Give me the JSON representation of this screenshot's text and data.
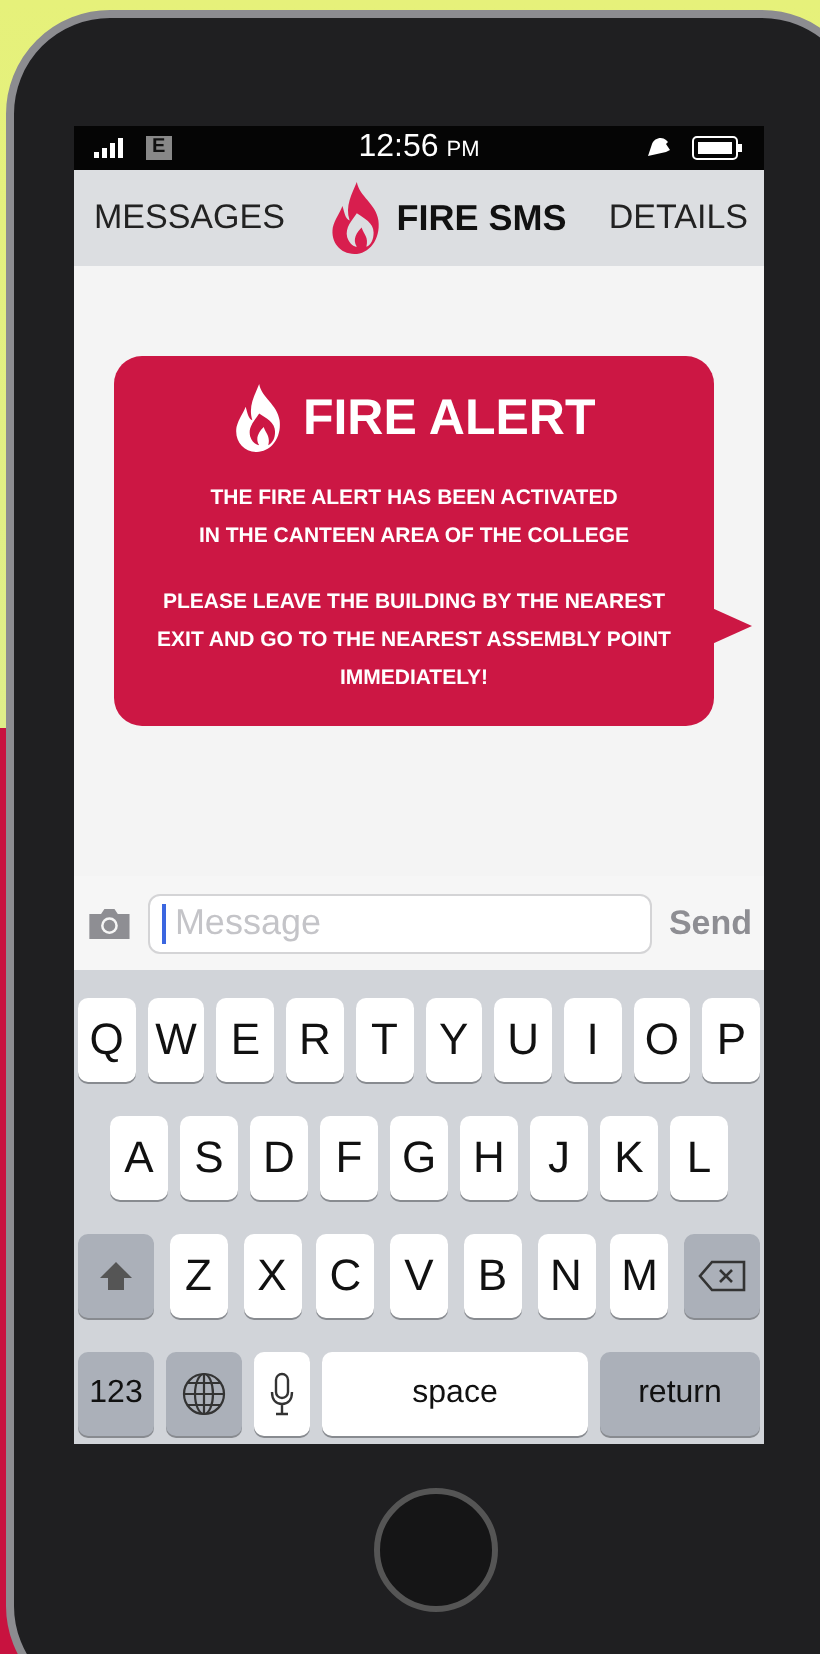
{
  "status_bar": {
    "network": "E",
    "time": "12:56",
    "ampm": "PM"
  },
  "nav": {
    "back": "MESSAGES",
    "title": "FIRE SMS",
    "details": "DETAILS"
  },
  "message": {
    "title": "FIRE ALERT",
    "paragraphs": [
      "THE FIRE ALERT HAS BEEN ACTIVATED\nIN THE CANTEEN AREA OF THE COLLEGE",
      "PLEASE LEAVE THE BUILDING BY THE NEAREST\nEXIT AND GO TO THE NEAREST ASSEMBLY POINT\nIMMEDIATELY!"
    ]
  },
  "compose": {
    "placeholder": "Message",
    "send": "Send"
  },
  "keyboard": {
    "top_row": [
      {
        "kind": "letter",
        "label": "Q"
      },
      {
        "kind": "letter",
        "label": "W"
      },
      {
        "kind": "letter",
        "label": "E"
      },
      {
        "kind": "letter",
        "label": "R"
      },
      {
        "kind": "letter",
        "label": "T"
      },
      {
        "kind": "letter",
        "label": "Y"
      },
      {
        "kind": "letter",
        "label": "U"
      },
      {
        "kind": "letter",
        "label": "I"
      },
      {
        "kind": "letter",
        "label": "O"
      },
      {
        "kind": "letter",
        "label": "P"
      }
    ],
    "middle_row": [
      {
        "kind": "letter",
        "label": "A"
      },
      {
        "kind": "letter",
        "label": "S"
      },
      {
        "kind": "letter",
        "label": "D"
      },
      {
        "kind": "letter",
        "label": "F"
      },
      {
        "kind": "letter",
        "label": "G"
      },
      {
        "kind": "letter",
        "label": "H"
      },
      {
        "kind": "letter",
        "label": "J"
      },
      {
        "kind": "letter",
        "label": "K"
      },
      {
        "kind": "letter",
        "label": "L"
      }
    ],
    "third_row": [
      {
        "kind": "shift"
      },
      {
        "kind": "letter",
        "label": "Z"
      },
      {
        "kind": "letter",
        "label": "X"
      },
      {
        "kind": "letter",
        "label": "C"
      },
      {
        "kind": "letter",
        "label": "V"
      },
      {
        "kind": "letter",
        "label": "B"
      },
      {
        "kind": "letter",
        "label": "N"
      },
      {
        "kind": "letter",
        "label": "M"
      },
      {
        "kind": "delete"
      }
    ],
    "bottom_row": [
      {
        "kind": "numbers",
        "label": "123"
      },
      {
        "kind": "globe"
      },
      {
        "kind": "mic"
      },
      {
        "kind": "space",
        "label": "space"
      },
      {
        "kind": "return",
        "label": "return"
      }
    ]
  }
}
